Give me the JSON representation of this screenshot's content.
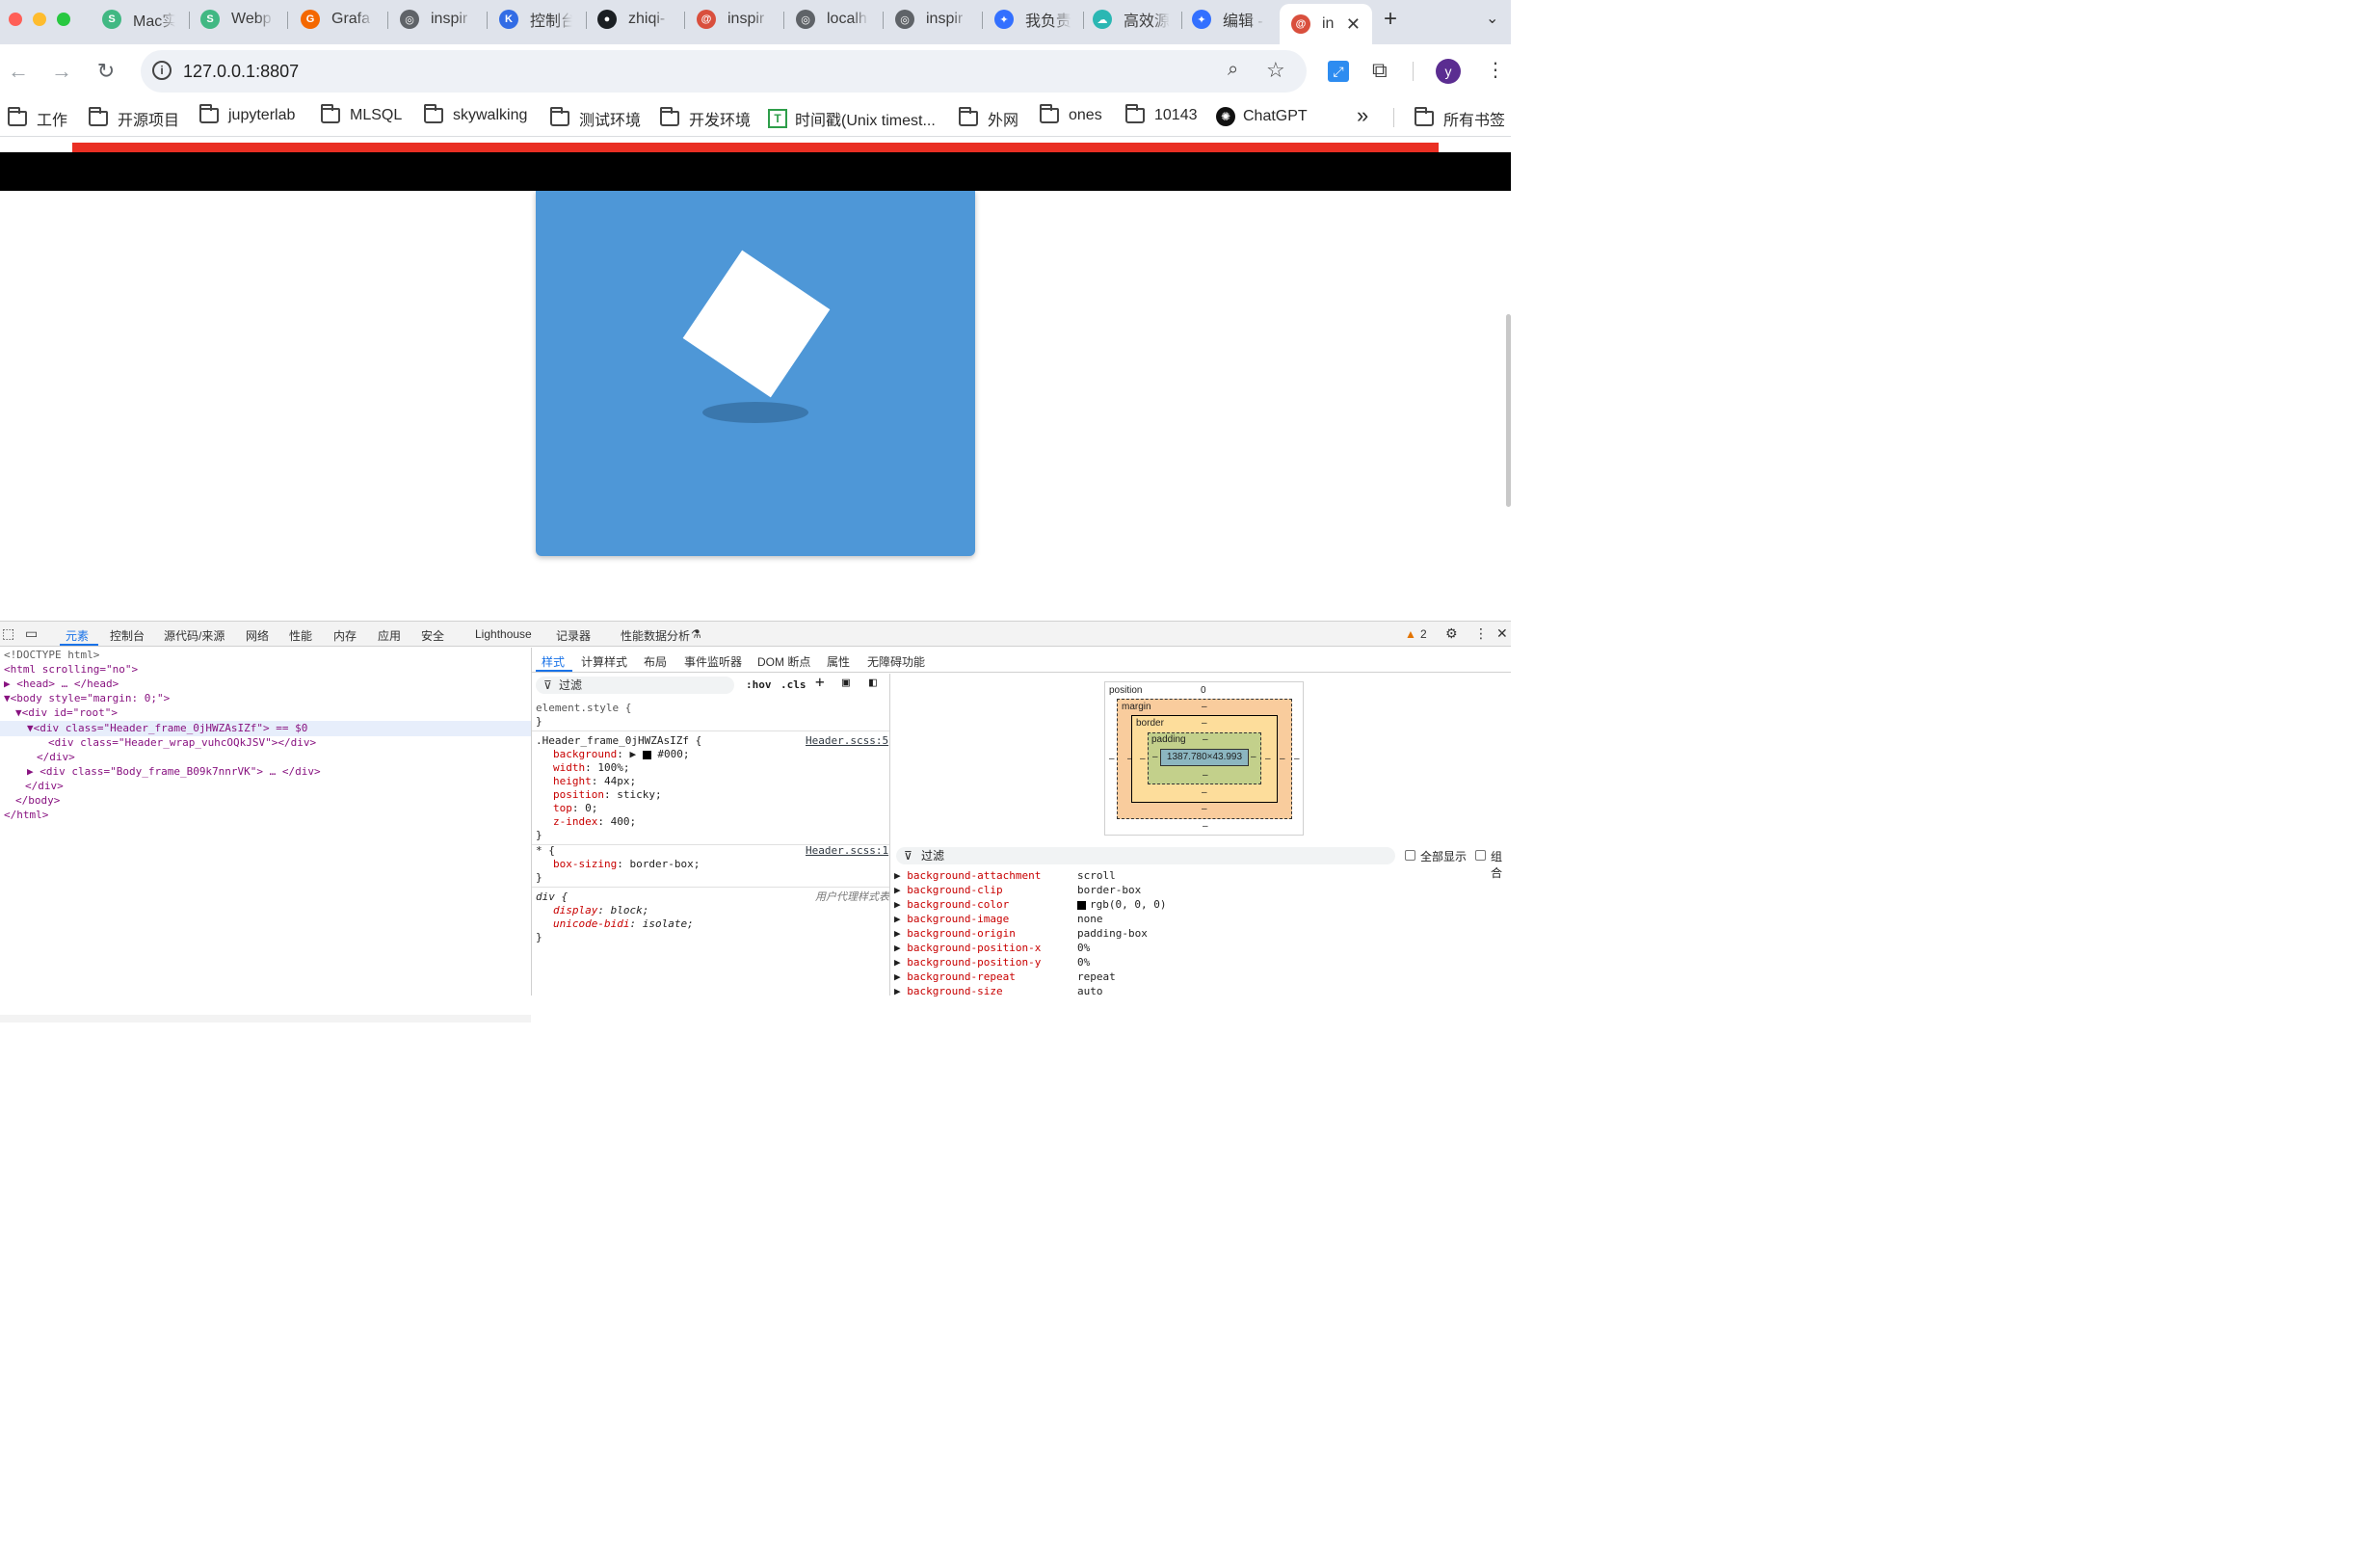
{
  "browser": {
    "tabs": [
      {
        "title": "Mac实",
        "icon": "vue-icon",
        "color": "#41b883"
      },
      {
        "title": "Webp",
        "icon": "vue-icon",
        "color": "#41b883"
      },
      {
        "title": "Grafa",
        "icon": "grafana-icon",
        "color": "#f46800"
      },
      {
        "title": "inspir",
        "icon": "globe-icon",
        "color": "#5f6368"
      },
      {
        "title": "控制台",
        "icon": "k-icon",
        "color": "#326ce5"
      },
      {
        "title": "zhiqi-",
        "icon": "github-icon",
        "color": "#1b1f23"
      },
      {
        "title": "inspir",
        "icon": "app-icon",
        "color": "#d94f3d"
      },
      {
        "title": "localh",
        "icon": "globe-icon",
        "color": "#5f6368"
      },
      {
        "title": "inspir",
        "icon": "globe-icon",
        "color": "#5f6368"
      },
      {
        "title": "我负责",
        "icon": "feishu-icon",
        "color": "#3370ff"
      },
      {
        "title": "高效源",
        "icon": "cloud-icon",
        "color": "#2bb7b3"
      },
      {
        "title": "编辑 -",
        "icon": "feishu-icon",
        "color": "#3370ff"
      }
    ],
    "active_tab": {
      "title": "in",
      "icon": "app-icon",
      "color": "#d94f3d"
    },
    "new_tab_symbol": "+",
    "url": "127.0.0.1:8807",
    "profile_initial": "y",
    "bookmarks": [
      {
        "label": "工作",
        "type": "folder"
      },
      {
        "label": "开源项目",
        "type": "folder"
      },
      {
        "label": "jupyterlab",
        "type": "folder"
      },
      {
        "label": "MLSQL",
        "type": "folder"
      },
      {
        "label": "skywalking",
        "type": "folder"
      },
      {
        "label": "测试环境",
        "type": "folder"
      },
      {
        "label": "开发环境",
        "type": "folder"
      },
      {
        "label": "时间戳(Unix timest...",
        "type": "page"
      },
      {
        "label": "外网",
        "type": "folder"
      },
      {
        "label": "ones",
        "type": "folder"
      },
      {
        "label": "10143",
        "type": "folder"
      },
      {
        "label": "ChatGPT",
        "type": "page"
      }
    ],
    "bookmarks_overflow": "»",
    "all_bookmarks": "所有书签"
  },
  "page": {
    "header_color": "#000000",
    "accent_line_color": "#ea2f23",
    "card_color": "#4e97d7"
  },
  "devtools": {
    "tabs": [
      "元素",
      "控制台",
      "源代码/来源",
      "网络",
      "性能",
      "内存",
      "应用",
      "安全",
      "Lighthouse",
      "记录器",
      "性能数据分析"
    ],
    "active_tab": "元素",
    "warnings_count": "2",
    "dom_lines": [
      "<!DOCTYPE html>",
      "<html scrolling=\"no\">",
      "<head> … </head>",
      "<body style=\"margin: 0;\">",
      "<div id=\"root\">",
      "<div class=\"Header_frame_0jHWZAsIZf\"> == $0",
      "<div class=\"Header_wrap_vuhcOQkJSV\"></div>",
      "</div>",
      "<div class=\"Body_frame_B09k7nnrVK\"> … </div>",
      "</div>",
      "</body>",
      "</html>"
    ],
    "side_tabs": [
      "样式",
      "计算样式",
      "布局",
      "事件监听器",
      "DOM 断点",
      "属性",
      "无障碍功能"
    ],
    "styles_filter_placeholder": "过滤",
    "hov": ":hov",
    "cls": ".cls",
    "rules": {
      "element_style": "element.style {",
      "header_selector": ".Header_frame_0jHWZAsIZf {",
      "header_source": "Header.scss:5",
      "header_props": [
        {
          "name": "background",
          "value": "#000;"
        },
        {
          "name": "width",
          "value": "100%;"
        },
        {
          "name": "height",
          "value": "44px;"
        },
        {
          "name": "position",
          "value": "sticky;"
        },
        {
          "name": "top",
          "value": "0;"
        },
        {
          "name": "z-index",
          "value": "400;"
        }
      ],
      "star_selector": "* {",
      "star_source": "Header.scss:1",
      "star_prop": {
        "name": "box-sizing",
        "value": "border-box;"
      },
      "div_selector": "div {",
      "div_source": "用户代理样式表",
      "div_props": [
        {
          "name": "display",
          "value": "block;"
        },
        {
          "name": "unicode-bidi",
          "value": "isolate;"
        }
      ],
      "close_brace": "}"
    },
    "box_model": {
      "position_label": "position",
      "position_value": "0",
      "margin_label": "margin",
      "border_label": "border",
      "padding_label": "padding",
      "dash": "–",
      "content_size": "1387.780×43.993"
    },
    "computed_filter_placeholder": "过滤",
    "show_all": "全部显示",
    "group": "组合",
    "computed": [
      {
        "name": "background-attachment",
        "value": "scroll"
      },
      {
        "name": "background-clip",
        "value": "border-box"
      },
      {
        "name": "background-color",
        "value": "rgb(0, 0, 0)"
      },
      {
        "name": "background-image",
        "value": "none"
      },
      {
        "name": "background-origin",
        "value": "padding-box"
      },
      {
        "name": "background-position-x",
        "value": "0%"
      },
      {
        "name": "background-position-y",
        "value": "0%"
      },
      {
        "name": "background-repeat",
        "value": "repeat"
      },
      {
        "name": "background-size",
        "value": "auto"
      }
    ]
  }
}
